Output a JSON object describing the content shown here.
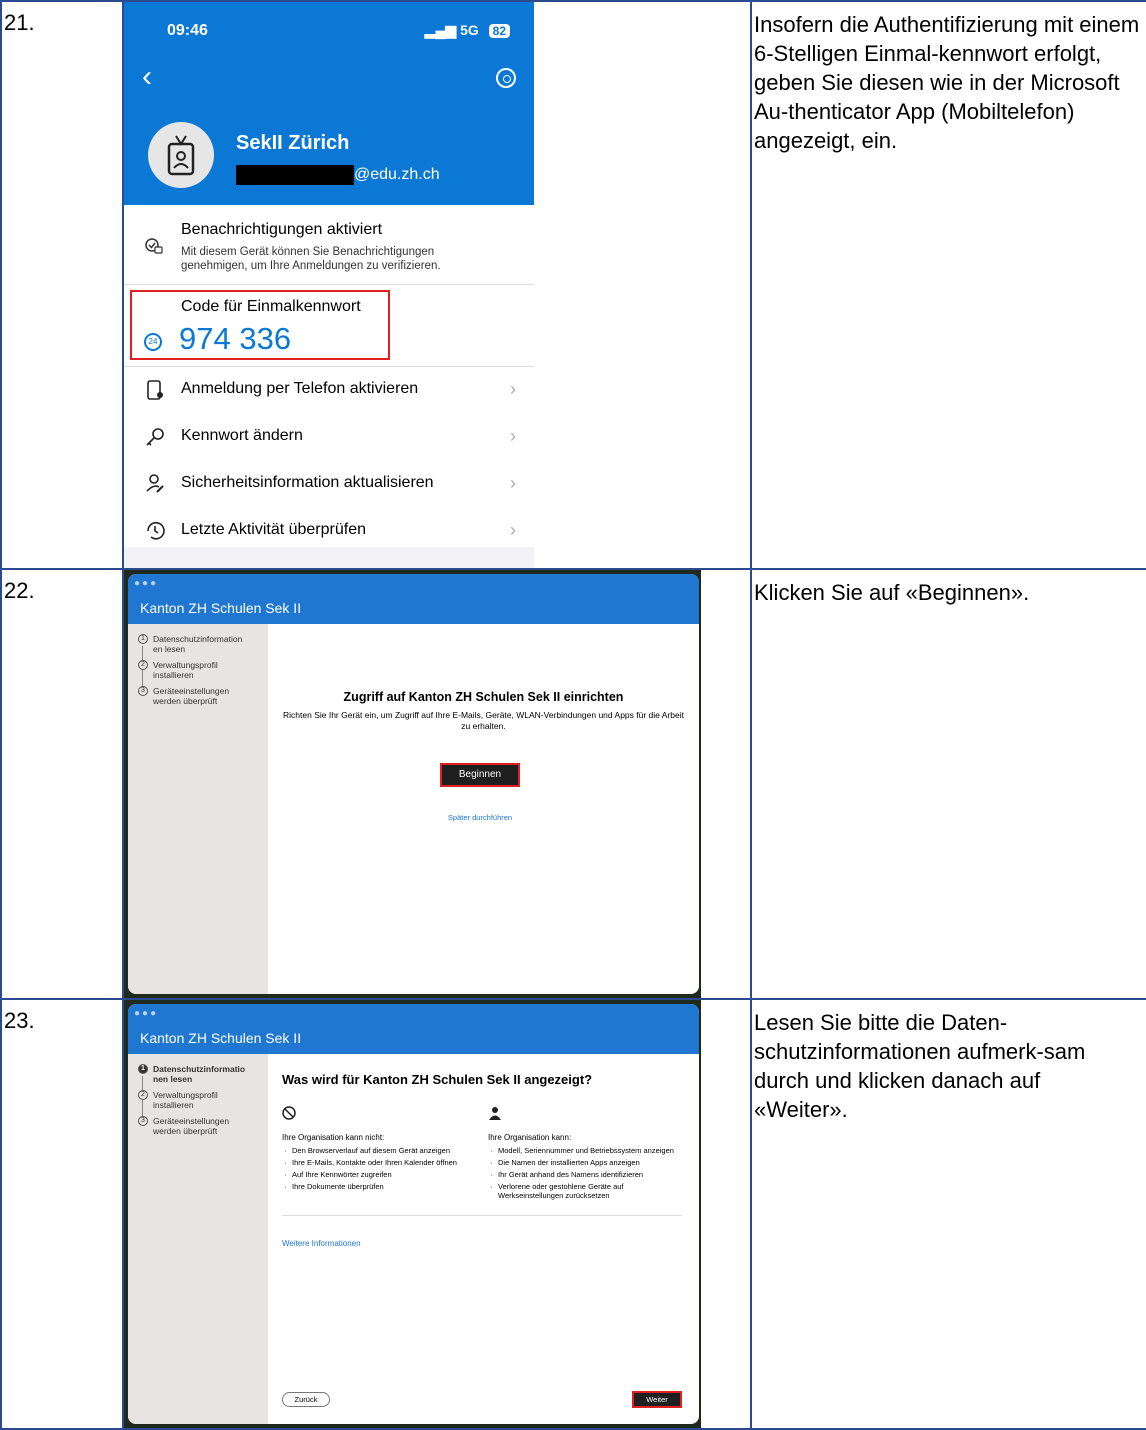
{
  "rows": [
    {
      "number": "21.",
      "description": "Insofern die Authentifizierung mit einem 6-Stelligen Einmal-kennwort erfolgt, geben Sie diesen wie in der Microsoft Au-thenticator App (Mobiltelefon) angezeigt, ein.",
      "phone": {
        "time": "09:46",
        "network": "5G",
        "battery": "82",
        "account_name": "SekII Zürich",
        "email_suffix": "@edu.zh.ch",
        "notifications_title": "Benachrichtigungen aktiviert",
        "notifications_text": "Mit diesem Gerät können Sie Benachrichtigungen genehmigen, um Ihre Anmeldungen zu verifizieren.",
        "otp_label": "Code für Einmalkennwort",
        "otp_timer": "24",
        "otp_code": "974 336",
        "menu": [
          {
            "label": "Anmeldung per Telefon aktivieren",
            "icon": "phone-sign-in-icon"
          },
          {
            "label": "Kennwort ändern",
            "icon": "key-icon"
          },
          {
            "label": "Sicherheitsinformation aktualisieren",
            "icon": "user-edit-icon"
          },
          {
            "label": "Letzte Aktivität überprüfen",
            "icon": "history-icon"
          }
        ]
      }
    },
    {
      "number": "22.",
      "description": "Klicken Sie auf «Beginnen».",
      "app": {
        "title": "Kanton ZH Schulen Sek II",
        "steps": [
          {
            "n": "1",
            "label": "Datenschutzinformation en lesen"
          },
          {
            "n": "2",
            "label": "Verwaltungsprofil installieren"
          },
          {
            "n": "3",
            "label": "Geräteeinstellungen werden überprüft"
          }
        ],
        "heading": "Zugriff auf Kanton ZH Schulen Sek II einrichten",
        "subtext": "Richten Sie Ihr Gerät ein, um Zugriff auf Ihre E-Mails, Geräte, WLAN-Verbindungen und Apps für die Arbeit zu erhalten.",
        "start_button": "Beginnen",
        "later_link": "Später durchführen"
      }
    },
    {
      "number": "23.",
      "description": "Lesen Sie bitte die Daten-schutzinformationen aufmerk-sam durch und klicken danach auf «Weiter».",
      "app": {
        "title": "Kanton ZH Schulen Sek II",
        "steps": [
          {
            "n": "1",
            "label": "Datenschutzinformatio nen lesen"
          },
          {
            "n": "2",
            "label": "Verwaltungsprofil installieren"
          },
          {
            "n": "3",
            "label": "Geräteeinstellungen werden überprüft"
          }
        ],
        "heading": "Was wird für Kanton ZH Schulen Sek II angezeigt?",
        "cannot_header": "Ihre Organisation kann nicht:",
        "cannot_items": [
          "Den Browserverlauf auf diesem Gerät anzeigen",
          "Ihre E-Mails, Kontakte oder Ihren Kalender öffnen",
          "Auf Ihre Kennwörter zugreifen",
          "Ihre Dokumente überprüfen"
        ],
        "can_header": "Ihre Organisation kann:",
        "can_items": [
          "Modell, Seriennummer und Betriebssystem anzeigen",
          "Die Namen der installierten Apps anzeigen",
          "Ihr Gerät anhand des Namens identifizieren",
          "Verlorene oder gestohlene Geräte auf Werkseinstellungen zurücksetzen"
        ],
        "more_link": "Weitere Informationen",
        "back_button": "Zurück",
        "next_button": "Weiter"
      }
    }
  ]
}
